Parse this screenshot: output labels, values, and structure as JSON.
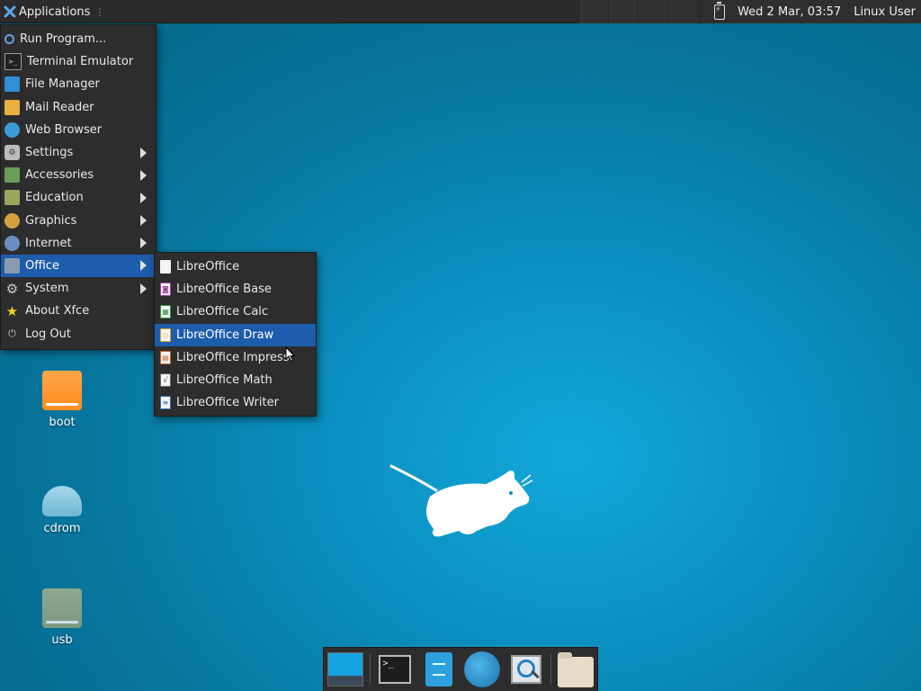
{
  "panel": {
    "applications_label": "Applications",
    "clock": "Wed  2 Mar, 03:57",
    "user": "Linux User"
  },
  "main_menu": {
    "items": [
      {
        "label": "Run Program...",
        "icon": "search-run-icon",
        "submenu": false
      },
      {
        "label": "Terminal Emulator",
        "icon": "terminal-icon",
        "submenu": false
      },
      {
        "label": "File Manager",
        "icon": "file-manager-icon",
        "submenu": false
      },
      {
        "label": "Mail Reader",
        "icon": "mail-icon",
        "submenu": false
      },
      {
        "label": "Web Browser",
        "icon": "globe-icon",
        "submenu": false
      },
      {
        "label": "Settings",
        "icon": "settings-icon",
        "submenu": true
      },
      {
        "label": "Accessories",
        "icon": "accessories-icon",
        "submenu": true
      },
      {
        "label": "Education",
        "icon": "education-icon",
        "submenu": true
      },
      {
        "label": "Graphics",
        "icon": "graphics-icon",
        "submenu": true
      },
      {
        "label": "Internet",
        "icon": "internet-icon",
        "submenu": true
      },
      {
        "label": "Office",
        "icon": "office-icon",
        "submenu": true,
        "active": true
      },
      {
        "label": "System",
        "icon": "gear-icon",
        "submenu": true
      },
      {
        "label": "About Xfce",
        "icon": "star-icon",
        "submenu": false
      },
      {
        "label": "Log Out",
        "icon": "logout-icon",
        "submenu": false
      }
    ]
  },
  "office_menu": {
    "items": [
      {
        "label": "LibreOffice",
        "icon": "libreoffice-icon"
      },
      {
        "label": "LibreOffice Base",
        "icon": "libreoffice-base-icon"
      },
      {
        "label": "LibreOffice Calc",
        "icon": "libreoffice-calc-icon"
      },
      {
        "label": "LibreOffice Draw",
        "icon": "libreoffice-draw-icon",
        "active": true
      },
      {
        "label": "LibreOffice Impress",
        "icon": "libreoffice-impress-icon"
      },
      {
        "label": "LibreOffice Math",
        "icon": "libreoffice-math-icon"
      },
      {
        "label": "LibreOffice Writer",
        "icon": "libreoffice-writer-icon"
      }
    ]
  },
  "desktop_icons": [
    {
      "label": "boot",
      "icon": "drive-icon"
    },
    {
      "label": "cdrom",
      "icon": "cdrom-icon"
    },
    {
      "label": "usb",
      "icon": "usb-drive-icon"
    }
  ],
  "dock": {
    "items": [
      "show-desktop",
      "terminal",
      "file-manager",
      "web-browser",
      "app-finder",
      "home-folder"
    ]
  },
  "colors": {
    "menu_bg": "#2d2d2d",
    "highlight": "#1e5dac",
    "desktop": "#0a8fc0"
  }
}
